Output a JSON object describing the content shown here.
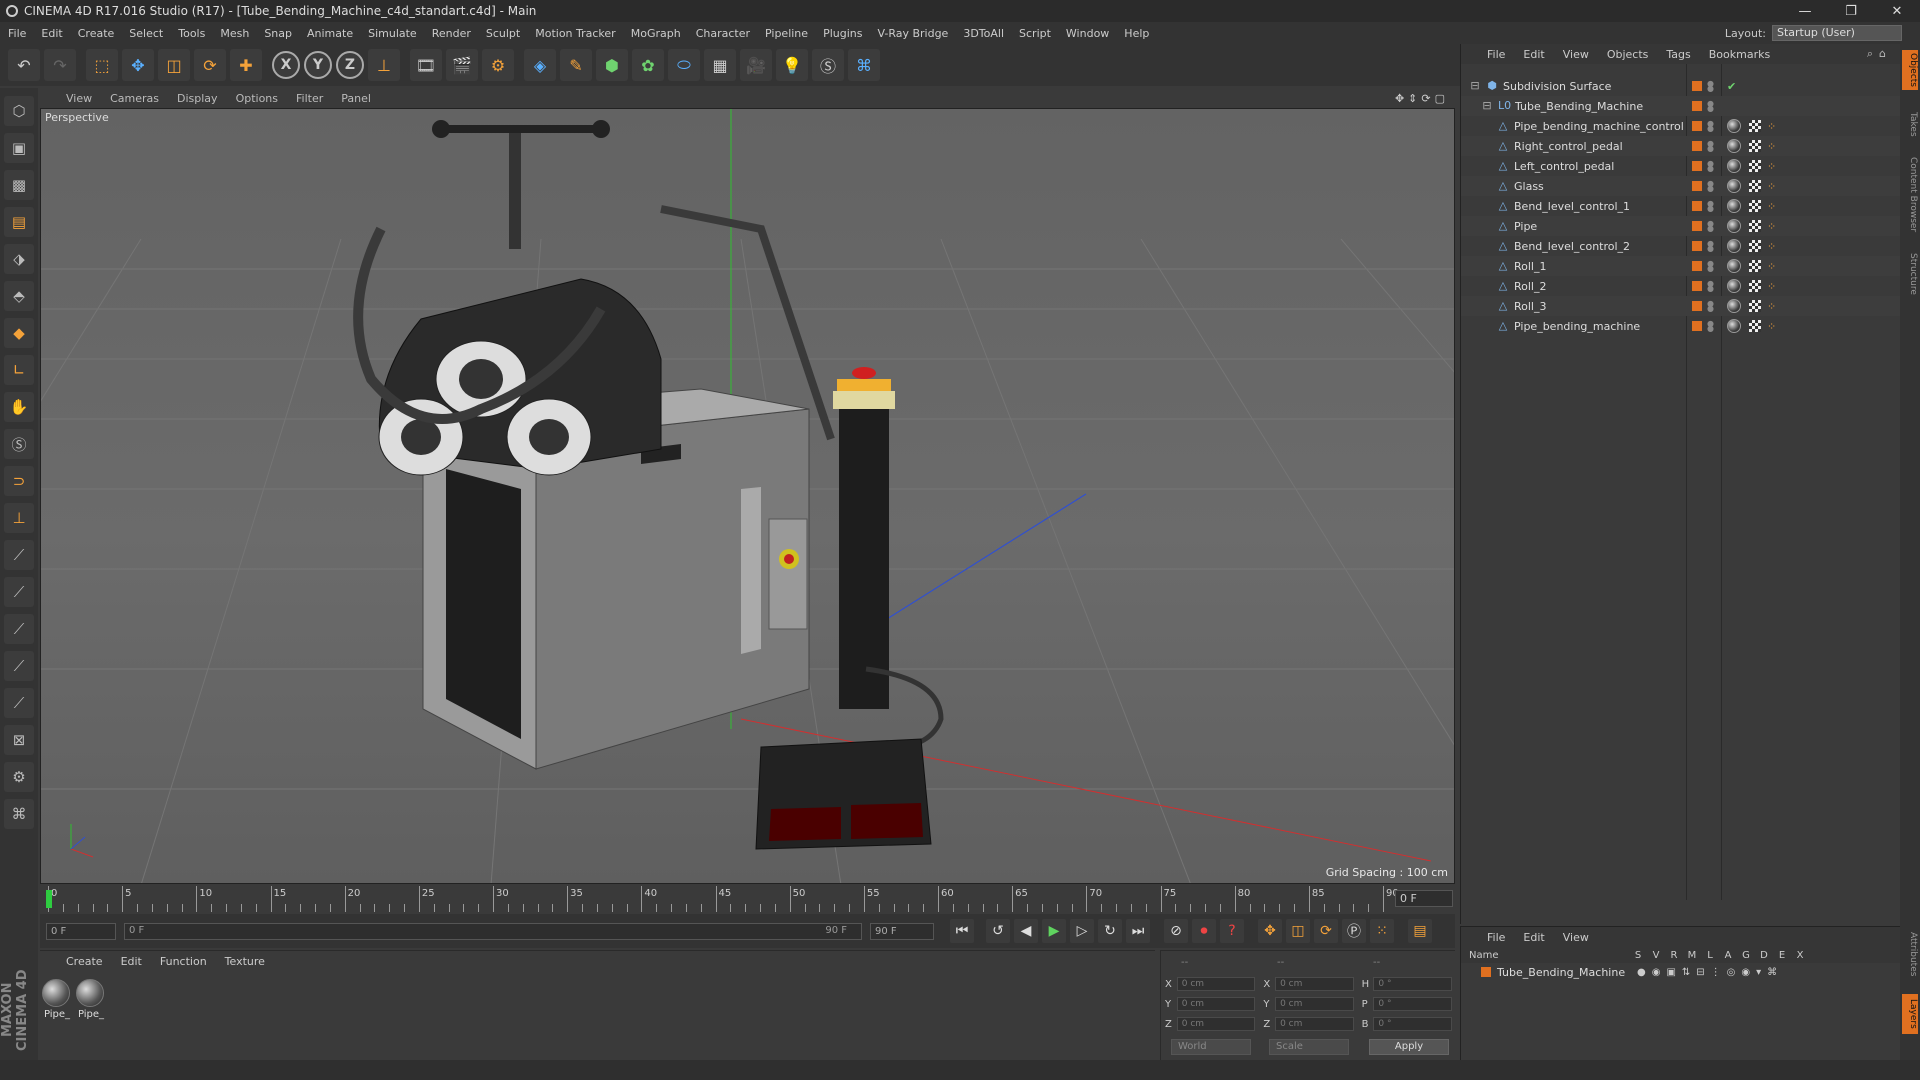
{
  "window": {
    "title": "CINEMA 4D R17.016 Studio (R17) - [Tube_Bending_Machine_c4d_standart.c4d] - Main",
    "min": "—",
    "max": "❐",
    "close": "✕"
  },
  "menubar": {
    "items": [
      "File",
      "Edit",
      "Create",
      "Select",
      "Tools",
      "Mesh",
      "Snap",
      "Animate",
      "Simulate",
      "Render",
      "Sculpt",
      "Motion Tracker",
      "MoGraph",
      "Character",
      "Pipeline",
      "Plugins",
      "V-Ray Bridge",
      "3DToAll",
      "Script",
      "Window",
      "Help"
    ],
    "layout_label": "Layout:",
    "layout_value": "Startup (User)"
  },
  "toolbar": {
    "icons": [
      "undo-icon",
      "redo-icon",
      "live-select-icon",
      "move-icon",
      "scale-icon",
      "rotate-icon",
      "last-tool-icon",
      "x-axis-icon",
      "y-axis-icon",
      "z-axis-icon",
      "coordinate-system-icon",
      "render-view-icon",
      "render-picture-viewer-icon",
      "edit-render-settings-icon",
      "cube-icon",
      "pen-icon",
      "subdivision-icon",
      "array-icon",
      "deformer-icon",
      "floor-icon",
      "camera-icon",
      "light-icon",
      "vray-icon",
      "python-icon"
    ],
    "x_label": "X",
    "y_label": "Y",
    "z_label": "Z"
  },
  "viewport": {
    "menu": [
      "View",
      "Cameras",
      "Display",
      "Options",
      "Filter",
      "Panel"
    ],
    "nav_icons": "✥⇕⟳▢",
    "label": "Perspective",
    "grid_spacing": "Grid Spacing : 100 cm"
  },
  "timeline": {
    "ticks": [
      "0",
      "5",
      "10",
      "15",
      "20",
      "25",
      "30",
      "35",
      "40",
      "45",
      "50",
      "55",
      "60",
      "65",
      "70",
      "75",
      "80",
      "85",
      "90"
    ],
    "current_frame": "0 F"
  },
  "playbar": {
    "start_field": "0 F",
    "range_start": "0 F",
    "range_end": "90 F",
    "end_field": "90 F"
  },
  "materials": {
    "menu": [
      "Create",
      "Edit",
      "Function",
      "Texture"
    ],
    "items": [
      {
        "label": "Pipe_"
      },
      {
        "label": "Pipe_"
      }
    ]
  },
  "coordinates": {
    "header_a": "--",
    "header_b": "--",
    "header_c": "--",
    "rows": [
      {
        "a": "X",
        "av": "0 cm",
        "b": "X",
        "bv": "0 cm",
        "c": "H",
        "cv": "0 °"
      },
      {
        "a": "Y",
        "av": "0 cm",
        "b": "Y",
        "bv": "0 cm",
        "c": "P",
        "cv": "0 °"
      },
      {
        "a": "Z",
        "av": "0 cm",
        "b": "Z",
        "bv": "0 cm",
        "c": "B",
        "cv": "0 °"
      }
    ],
    "world": "World",
    "scale": "Scale",
    "apply": "Apply"
  },
  "objects": {
    "menu": [
      "File",
      "Edit",
      "View",
      "Objects",
      "Tags",
      "Bookmarks"
    ],
    "tree": [
      {
        "name": "Subdivision Surface"
      },
      {
        "name": "Tube_Bending_Machine"
      },
      {
        "name": "Pipe_bending_machine_control"
      },
      {
        "name": "Right_control_pedal"
      },
      {
        "name": "Left_control_pedal"
      },
      {
        "name": "Glass"
      },
      {
        "name": "Bend_level_control_1"
      },
      {
        "name": "Pipe"
      },
      {
        "name": "Bend_level_control_2"
      },
      {
        "name": "Roll_1"
      },
      {
        "name": "Roll_2"
      },
      {
        "name": "Roll_3"
      },
      {
        "name": "Pipe_bending_machine"
      }
    ]
  },
  "layers": {
    "menu": [
      "File",
      "Edit",
      "View"
    ],
    "columns": [
      "Name",
      "S",
      "V",
      "R",
      "M",
      "L",
      "A",
      "G",
      "D",
      "E",
      "X"
    ],
    "rows": [
      {
        "name": "Tube_Bending_Machine"
      }
    ]
  },
  "side_tabs": [
    "Objects",
    "Takes",
    "Content Browser",
    "Structure",
    "Attributes",
    "Layers"
  ],
  "brand": "MAXON CINEMA 4D",
  "colors": {
    "accent": "#e07020",
    "x_axis": "#d03030",
    "y_axis": "#30c030",
    "z_axis": "#3050d0"
  }
}
